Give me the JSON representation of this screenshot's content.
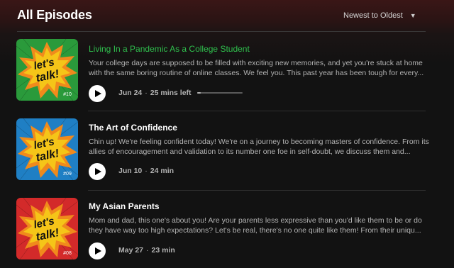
{
  "header": {
    "title": "All Episodes",
    "sort_label": "Newest to Oldest",
    "sort_icon": "caret-down-icon"
  },
  "episodes": [
    {
      "title": "Living In a Pandemic As a College Student",
      "description": "Your college days are supposed to be filled with exciting new memories, and yet you're stuck at home with the same boring routine of online classes. We feel you. This past year has been tough for every...",
      "date": "Jun 24",
      "duration": "25 mins left",
      "progress": 0.08,
      "cover_number": "#10",
      "cover_color": "#2a9a3b",
      "cover_text_line1": "let's",
      "cover_text_line2": "talk!",
      "active": true
    },
    {
      "title": "The Art of Confidence",
      "description": "Chin up! We're feeling confident today! We're on a journey to becoming masters of confidence. From its allies of encouragement and validation to its number one foe in self-doubt, we discuss them and...",
      "date": "Jun 10",
      "duration": "24 min",
      "cover_number": "#09",
      "cover_color": "#1f7fc4",
      "cover_text_line1": "let's",
      "cover_text_line2": "talk!",
      "active": false
    },
    {
      "title": "My Asian Parents",
      "description": "Mom and dad, this one's about you! Are your parents less expressive than you'd like them to be or do they have way too high expectations? Let's be real, there's no one quite like them! From their uniqu...",
      "date": "May 27",
      "duration": "23 min",
      "cover_number": "#08",
      "cover_color": "#d32a2a",
      "cover_text_line1": "let's",
      "cover_text_line2": "talk!",
      "active": false
    }
  ],
  "colors": {
    "accent_green": "#2fbf4d",
    "burst_yellow": "#f5c518",
    "burst_orange": "#f08a1c"
  }
}
